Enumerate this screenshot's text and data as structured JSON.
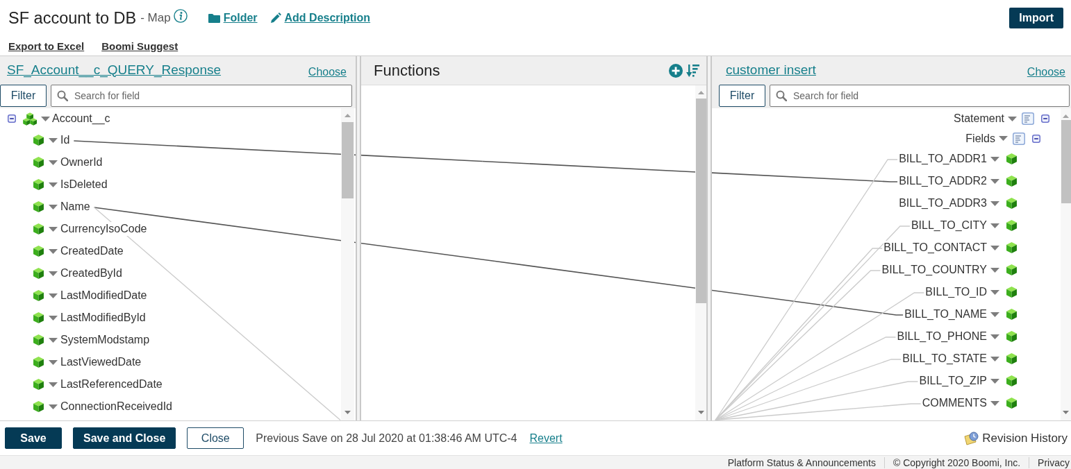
{
  "header": {
    "title": "SF account to DB",
    "type_label": "- Map",
    "links": [
      {
        "kind": "folder",
        "label": "Folder"
      },
      {
        "kind": "description",
        "label": "Add Description"
      }
    ],
    "import_button": "Import"
  },
  "toolbar": {
    "links": [
      "Export to Excel",
      "Boomi Suggest"
    ]
  },
  "source": {
    "title": "SF_Account__c_QUERY_Response",
    "choose": "Choose",
    "filter_button": "Filter",
    "search": {
      "placeholder": "Search for field"
    },
    "tree": {
      "label": "Account__c",
      "expanded": true,
      "children": [
        {
          "label": "Id",
          "mapped": true,
          "faint_link": false
        },
        {
          "label": "OwnerId",
          "mapped": false,
          "faint_link": false
        },
        {
          "label": "IsDeleted",
          "mapped": false,
          "faint_link": false
        },
        {
          "label": "Name",
          "mapped": true,
          "faint_link": true
        },
        {
          "label": "CurrencyIsoCode",
          "mapped": false,
          "faint_link": false
        },
        {
          "label": "CreatedDate",
          "mapped": false,
          "faint_link": false
        },
        {
          "label": "CreatedById",
          "mapped": false,
          "faint_link": false
        },
        {
          "label": "LastModifiedDate",
          "mapped": false,
          "faint_link": false
        },
        {
          "label": "LastModifiedById",
          "mapped": false,
          "faint_link": false
        },
        {
          "label": "SystemModstamp",
          "mapped": false,
          "faint_link": false
        },
        {
          "label": "LastViewedDate",
          "mapped": false,
          "faint_link": false
        },
        {
          "label": "LastReferencedDate",
          "mapped": false,
          "faint_link": false
        },
        {
          "label": "ConnectionReceivedId",
          "mapped": false,
          "faint_link": false
        }
      ]
    }
  },
  "functions": {
    "title": "Functions"
  },
  "target": {
    "title": "customer insert",
    "choose": "Choose",
    "filter_button": "Filter",
    "search": {
      "placeholder": "Search for field"
    },
    "tree": {
      "label": "Statement",
      "expanded": true,
      "children": [
        {
          "label": "Fields",
          "expanded": true,
          "children": [
            {
              "label": "BILL_TO_ADDR1",
              "mapped": false,
              "faint_link": true
            },
            {
              "label": "BILL_TO_ADDR2",
              "mapped": true,
              "faint_link": false
            },
            {
              "label": "BILL_TO_ADDR3",
              "mapped": false,
              "faint_link": false
            },
            {
              "label": "BILL_TO_CITY",
              "mapped": false,
              "faint_link": true
            },
            {
              "label": "BILL_TO_CONTACT",
              "mapped": false,
              "faint_link": true
            },
            {
              "label": "BILL_TO_COUNTRY",
              "mapped": false,
              "faint_link": true
            },
            {
              "label": "BILL_TO_ID",
              "mapped": false,
              "faint_link": true
            },
            {
              "label": "BILL_TO_NAME",
              "mapped": true,
              "faint_link": false
            },
            {
              "label": "BILL_TO_PHONE",
              "mapped": false,
              "faint_link": true
            },
            {
              "label": "BILL_TO_STATE",
              "mapped": false,
              "faint_link": true
            },
            {
              "label": "BILL_TO_ZIP",
              "mapped": false,
              "faint_link": true
            },
            {
              "label": "COMMENTS",
              "mapped": false,
              "faint_link": true
            }
          ]
        }
      ]
    }
  },
  "bottom_bar": {
    "buttons": [
      {
        "label": "Save",
        "kind": "primary"
      },
      {
        "label": "Save and Close",
        "kind": "primary"
      },
      {
        "label": "Close",
        "kind": "secondary"
      }
    ],
    "status": "Previous Save on 28 Jul 2020 at 01:38:46 AM UTC-4",
    "revert": "Revert",
    "revision_history": "Revision History"
  },
  "footer": {
    "links": [
      "Platform Status & Announcements",
      "© Copyright 2020 Boomi, Inc.",
      "Privacy"
    ]
  }
}
